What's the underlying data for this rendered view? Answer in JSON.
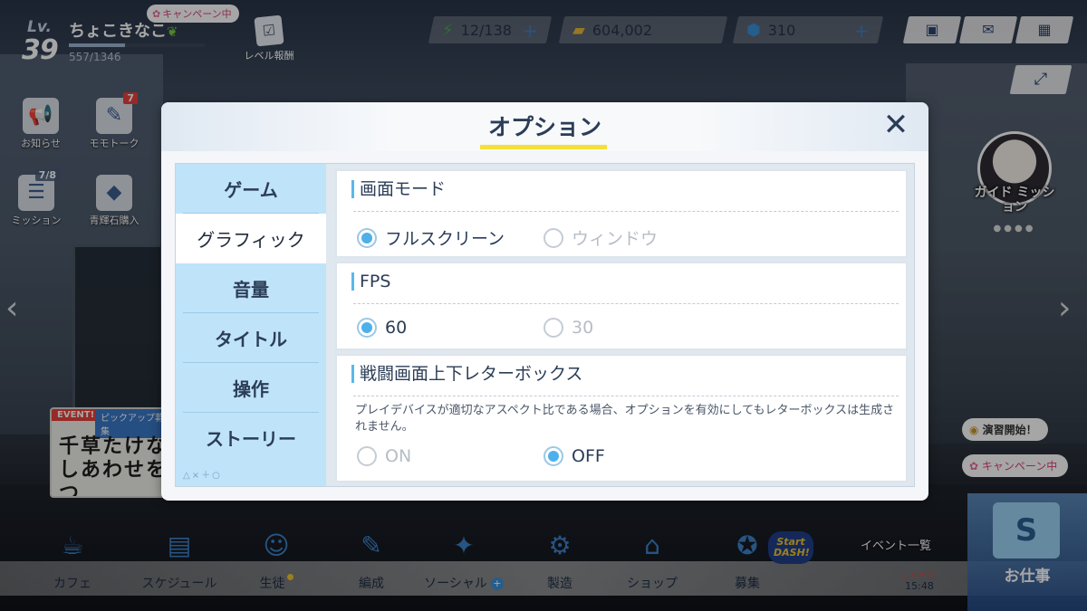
{
  "player": {
    "lv_label": "Lv.",
    "level": "39",
    "name": "ちょこきなこ",
    "exp_text": "557/1346",
    "exp_fraction": 0.414
  },
  "top": {
    "campaign_pill": "キャンペーン中",
    "level_reward_label": "レベル報酬",
    "resources": [
      {
        "icon": "lightning-icon",
        "value": "12/138"
      },
      {
        "icon": "credit-icon",
        "value": "604,002"
      },
      {
        "icon": "pyroxene-icon",
        "value": "310"
      }
    ]
  },
  "side_left": [
    {
      "label": "お知らせ",
      "icon": "megaphone-icon"
    },
    {
      "label": "モモトーク",
      "icon": "momotalk-icon",
      "badge": "7"
    },
    {
      "label": "ミッション",
      "icon": "mission-icon",
      "badge": "7/8"
    },
    {
      "label": "青輝石購入",
      "icon": "shop-bag-icon"
    }
  ],
  "event_banner": {
    "tag": "EVENT!",
    "tag2": "ピックアップ募集",
    "handwriting_1": "千草たけな",
    "handwriting_2": "しあわせをつ"
  },
  "side_right": {
    "guide_label": "ガイド ミッション",
    "drill_label": "演習開始！",
    "campaign_label": "キャンペーン中"
  },
  "bottom": {
    "items": [
      {
        "label": "カフェ",
        "icon": "cafe-icon"
      },
      {
        "label": "スケジュール",
        "icon": "schedule-icon"
      },
      {
        "label": "生徒",
        "icon": "student-icon"
      },
      {
        "label": "編成",
        "icon": "formation-icon"
      },
      {
        "label": "ソーシャル",
        "icon": "social-icon"
      },
      {
        "label": "製造",
        "icon": "craft-icon"
      },
      {
        "label": "ショップ",
        "icon": "shop-icon"
      },
      {
        "label": "募集",
        "icon": "recruit-icon"
      }
    ],
    "event_list": "イベント一覧",
    "clock_syms": "△×＋○",
    "time": "15:48",
    "work_label": "お仕事",
    "start_dash": "Start DASH!"
  },
  "modal": {
    "title": "オプション",
    "close_symbol": "✕",
    "tabs": [
      "ゲーム",
      "グラフィック",
      "音量",
      "タイトル",
      "操作",
      "ストーリー"
    ],
    "active_tab": "グラフィック",
    "tab_syms": "△×＋○",
    "sections": {
      "screen_mode": {
        "title": "画面モード",
        "options": [
          "フルスクリーン",
          "ウィンドウ"
        ],
        "selected": "フルスクリーン"
      },
      "fps": {
        "title": "FPS",
        "options": [
          "60",
          "30"
        ],
        "selected": "60"
      },
      "letterbox": {
        "title": "戦闘画面上下レターボックス",
        "description": "プレイデバイスが適切なアスペクト比である場合、オプションを有効にしてもレターボックスは生成されません。",
        "options": [
          "ON",
          "OFF"
        ],
        "selected": "OFF"
      }
    }
  }
}
